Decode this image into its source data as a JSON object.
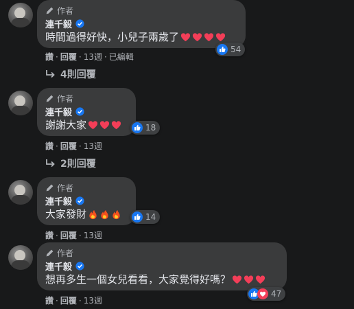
{
  "comments": [
    {
      "role": "作者",
      "name": "連千毅",
      "text": "時間過得好快，小兒子兩歲了",
      "emojis": [
        "heart",
        "heart",
        "heart",
        "heart"
      ],
      "reaction_count": "54",
      "meta": {
        "like": "讚",
        "reply": "回覆",
        "time": "13週",
        "edited": "已編輯"
      },
      "replies_label": "4則回覆"
    },
    {
      "role": "作者",
      "name": "連千毅",
      "text": "謝謝大家",
      "emojis": [
        "heart",
        "heart",
        "heart"
      ],
      "reaction_count": "18",
      "meta": {
        "like": "讚",
        "reply": "回覆",
        "time": "13週"
      },
      "replies_label": "2則回覆"
    },
    {
      "role": "作者",
      "name": "連千毅",
      "text": "大家發財",
      "emojis": [
        "fire",
        "fire",
        "fire"
      ],
      "reaction_count": "14",
      "meta": {
        "like": "讚",
        "reply": "回覆",
        "time": "13週"
      }
    },
    {
      "role": "作者",
      "name": "連千毅",
      "text": "想再多生一個女兒看看，大家覺得好嗎？",
      "emojis": [
        "heart",
        "heart",
        "heart"
      ],
      "reaction_count": "47",
      "meta": {
        "like": "讚",
        "reply": "回覆",
        "time": "13週"
      }
    }
  ],
  "colors": {
    "background": "#18191a",
    "bubble": "#3a3b3c",
    "like_blue": "#1877f2",
    "heart_red": "#f33e58",
    "secondary_text": "#b0b3b8"
  }
}
